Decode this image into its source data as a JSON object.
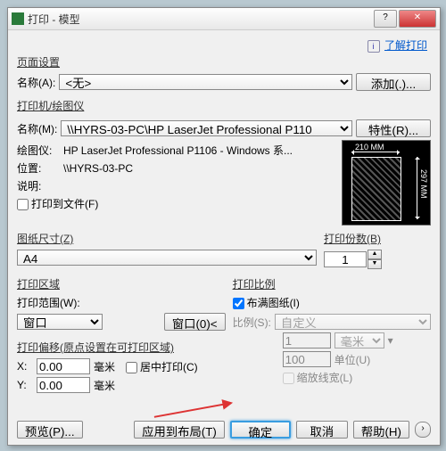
{
  "window": {
    "title": "打印 - 模型"
  },
  "help": {
    "icon": "i",
    "link": "了解打印"
  },
  "pageSetup": {
    "title": "页面设置",
    "nameLabel": "名称(A):",
    "nameValue": "<无>",
    "addBtn": "添加(.)..."
  },
  "printer": {
    "title": "打印机/绘图仪",
    "nameLabel": "名称(M):",
    "nameValue": "\\\\HYRS-03-PC\\HP LaserJet Professional P110",
    "propsBtn": "特性(R)...",
    "plotterLabel": "绘图仪:",
    "plotterValue": "HP LaserJet Professional P1106 - Windows 系...",
    "locationLabel": "位置:",
    "locationValue": "\\\\HYRS-03-PC",
    "descLabel": "说明:",
    "descValue": "",
    "toFileLabel": "打印到文件(F)",
    "preview": {
      "w": "210 MM",
      "h": "297 MM"
    }
  },
  "paper": {
    "title": "图纸尺寸(Z)",
    "value": "A4"
  },
  "copies": {
    "title": "打印份数(B)",
    "value": "1"
  },
  "area": {
    "title": "打印区域",
    "rangeLabel": "打印范围(W):",
    "rangeValue": "窗口",
    "windowBtn": "窗口(0)<"
  },
  "offset": {
    "title": "打印偏移(原点设置在可打印区域)",
    "xLabel": "X:",
    "xValue": "0.00",
    "xUnit": "毫米",
    "yLabel": "Y:",
    "yValue": "0.00",
    "yUnit": "毫米",
    "centerLabel": "居中打印(C)"
  },
  "scale": {
    "title": "打印比例",
    "fitLabel": "布满图纸(I)",
    "ratioLabel": "比例(S):",
    "ratioValue": "自定义",
    "num": "1",
    "numUnit": "毫米",
    "den": "100",
    "denUnit": "单位(U)",
    "lineweightLabel": "缩放线宽(L)"
  },
  "footer": {
    "previewBtn": "预览(P)...",
    "applyBtn": "应用到布局(T)",
    "okBtn": "确定",
    "cancelBtn": "取消",
    "helpBtn": "帮助(H)"
  }
}
